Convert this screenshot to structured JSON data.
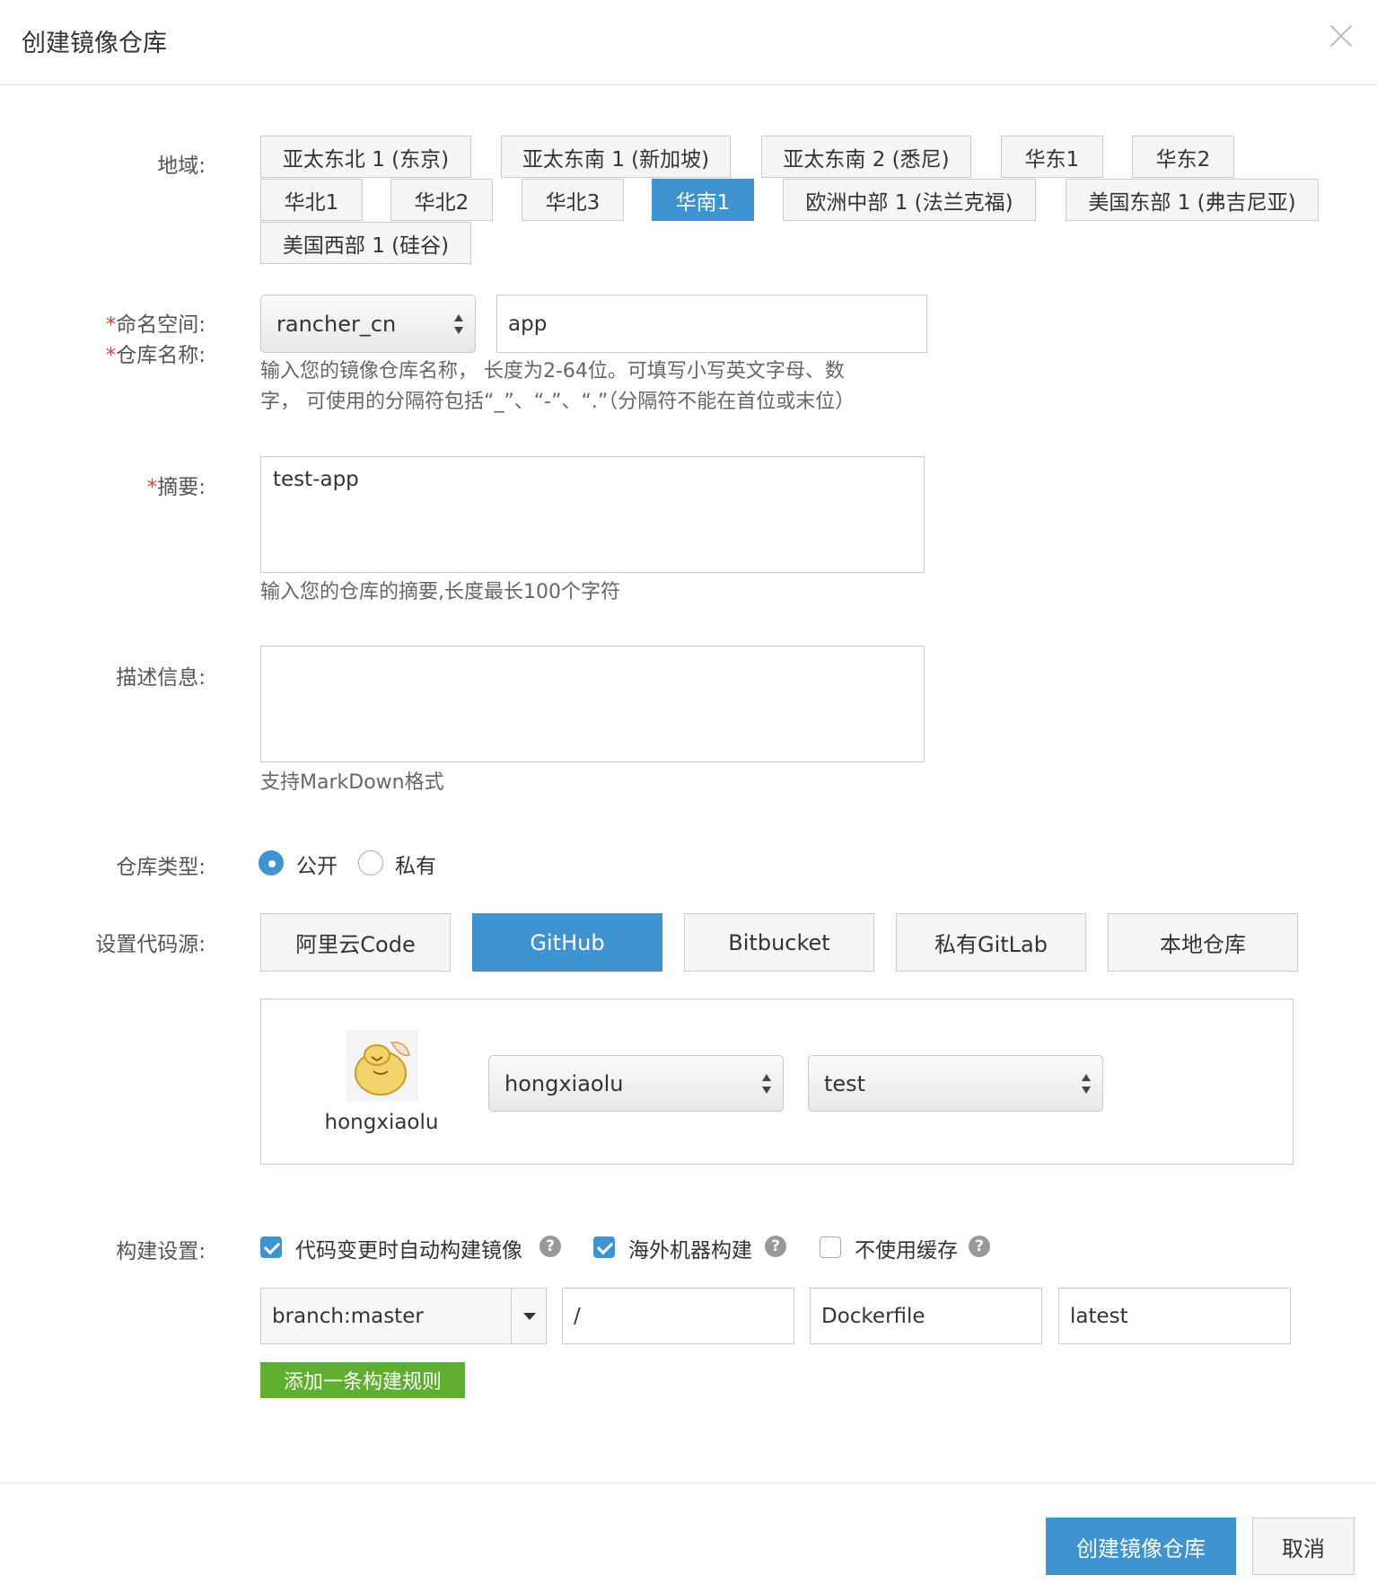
{
  "dialog": {
    "title": "创建镜像仓库"
  },
  "labels": {
    "region": "地域:",
    "namespace": "命名空间:",
    "repo_name": "仓库名称:",
    "summary": "摘要:",
    "description": "描述信息:",
    "repo_type": "仓库类型:",
    "code_source": "设置代码源:",
    "build_settings": "构建设置:",
    "required_mark": "*"
  },
  "regions": [
    {
      "label": "亚太东北 1 (东京)",
      "active": false
    },
    {
      "label": "亚太东南 1 (新加坡)",
      "active": false
    },
    {
      "label": "亚太东南 2 (悉尼)",
      "active": false
    },
    {
      "label": "华东1",
      "active": false
    },
    {
      "label": "华东2",
      "active": false
    },
    {
      "label": "华北1",
      "active": false
    },
    {
      "label": "华北2",
      "active": false
    },
    {
      "label": "华北3",
      "active": false
    },
    {
      "label": "华南1",
      "active": true
    },
    {
      "label": "欧洲中部 1 (法兰克福)",
      "active": false
    },
    {
      "label": "美国东部 1 (弗吉尼亚)",
      "active": false
    },
    {
      "label": "美国西部 1 (硅谷)",
      "active": false
    }
  ],
  "namespace": {
    "selected": "rancher_cn"
  },
  "repo_name": {
    "value": "app",
    "help_line1": "输入您的镜像仓库名称， 长度为2-64位。可填写小写英文字母、数",
    "help_line2": "字， 可使用的分隔符包括“_”、“-”、“.”（分隔符不能在首位或末位）"
  },
  "summary": {
    "value": "test-app",
    "help": "输入您的仓库的摘要,长度最长100个字符"
  },
  "description": {
    "value": "",
    "help": "支持MarkDown格式"
  },
  "repo_type": {
    "options": [
      {
        "label": "公开",
        "checked": true
      },
      {
        "label": "私有",
        "checked": false
      }
    ]
  },
  "code_sources": [
    {
      "label": "阿里云Code",
      "active": false
    },
    {
      "label": "GitHub",
      "active": true
    },
    {
      "label": "Bitbucket",
      "active": false
    },
    {
      "label": "私有GitLab",
      "active": false
    },
    {
      "label": "本地仓库",
      "active": false
    }
  ],
  "github": {
    "username": "hongxiaolu",
    "org_select": "hongxiaolu",
    "repo_select": "test"
  },
  "build": {
    "options": [
      {
        "label": "代码变更时自动构建镜像",
        "checked": true
      },
      {
        "label": "海外机器构建",
        "checked": true
      },
      {
        "label": "不使用缓存",
        "checked": false
      }
    ],
    "help_glyph": "?",
    "rule": {
      "branch": "branch:master",
      "directory": "/",
      "dockerfile": "Dockerfile",
      "tag": "latest"
    },
    "add_rule_label": "添加一条构建规则"
  },
  "footer": {
    "create_label": "创建镜像仓库",
    "cancel_label": "取消"
  },
  "colors": {
    "accent": "#3e94d1",
    "success": "#5fae2f",
    "required": "#e0432b"
  }
}
